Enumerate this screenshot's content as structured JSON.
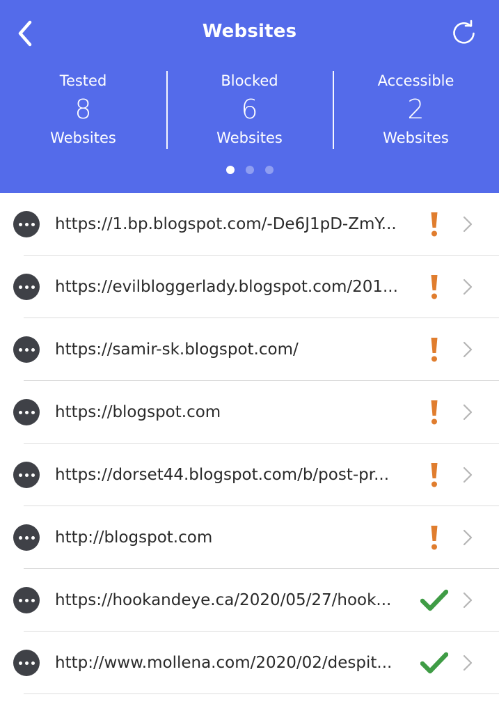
{
  "header": {
    "title": "Websites",
    "color": "#546bea"
  },
  "stats": [
    {
      "label": "Tested",
      "value": "8",
      "unit": "Websites"
    },
    {
      "label": "Blocked",
      "value": "6",
      "unit": "Websites"
    },
    {
      "label": "Accessible",
      "value": "2",
      "unit": "Websites"
    }
  ],
  "pager": {
    "count": 3,
    "active": 1
  },
  "icons": {
    "back": "chevron-left-icon",
    "refresh": "refresh-icon",
    "more": "more-horizontal-icon",
    "blocked": "exclamation-icon",
    "accessible": "checkmark-icon",
    "row_chevron": "chevron-right-icon"
  },
  "colors": {
    "blocked": "#e07d2e",
    "accessible": "#3f9c45"
  },
  "websites": [
    {
      "url": "https://1.bp.blogspot.com/-De6J1pD-ZmY...",
      "status": "blocked"
    },
    {
      "url": "https://evilbloggerlady.blogspot.com/201...",
      "status": "blocked"
    },
    {
      "url": "https://samir-sk.blogspot.com/",
      "status": "blocked"
    },
    {
      "url": "https://blogspot.com",
      "status": "blocked"
    },
    {
      "url": "https://dorset44.blogspot.com/b/post-pr...",
      "status": "blocked"
    },
    {
      "url": "http://blogspot.com",
      "status": "blocked"
    },
    {
      "url": "https://hookandeye.ca/2020/05/27/hook...",
      "status": "accessible"
    },
    {
      "url": "http://www.mollena.com/2020/02/despit...",
      "status": "accessible"
    }
  ]
}
